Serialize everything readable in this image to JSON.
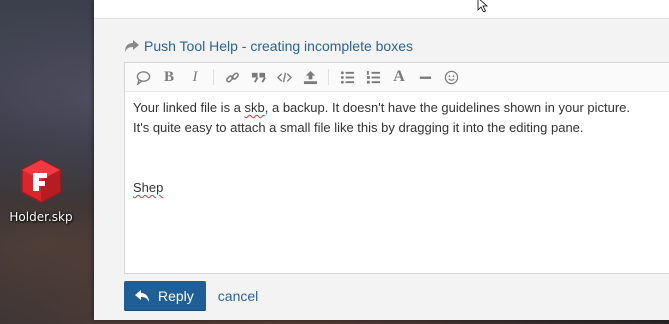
{
  "desktop": {
    "icon_label": "Holder.skp",
    "icon_name": "sketchup-file-icon"
  },
  "reply": {
    "heading_icon": "share-icon",
    "heading": "Push Tool Help - creating incomplete boxes"
  },
  "toolbar": {
    "buttons": [
      "comment-icon",
      "bold-icon",
      "italic-icon",
      "link-icon",
      "quote-icon",
      "code-icon",
      "upload-icon",
      "bullet-list-icon",
      "numbered-list-icon",
      "font-icon",
      "horizontal-rule-icon",
      "emoji-icon"
    ],
    "bold_glyph": "B",
    "italic_glyph": "I",
    "font_glyph": "A"
  },
  "editor": {
    "line1_pre": "Your linked file is a ",
    "line1_misspelled": "skb",
    "line1_post": ", a backup. It doesn't have the guidelines shown in your picture.",
    "line2": "It's quite easy to attach a small file like this by dragging it into the editing pane.",
    "signature": "Shep"
  },
  "actions": {
    "reply_label": "Reply",
    "cancel_label": "cancel"
  },
  "colors": {
    "accent": "#1f5f97",
    "link": "#2a6496",
    "spellcheck": "#dd3333"
  }
}
